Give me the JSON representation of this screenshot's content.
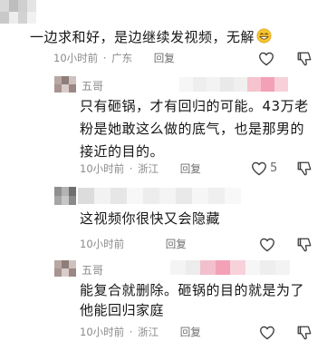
{
  "comments": [
    {
      "author": "",
      "text": "一边求和好，是边继续发视频，无解",
      "emoji": "grinning-face-emoji",
      "time": "10小时前",
      "location": "广东",
      "reply_label": "回复",
      "likes": ""
    },
    {
      "author": "五哥",
      "text": "只有砸锅，才有回归的可能。43万老粉是她敢这么做的底气，也是那男的接近的目的。",
      "time": "10小时前",
      "location": "浙江",
      "reply_label": "回复",
      "likes": "5"
    },
    {
      "author": "",
      "text": "这视频你很快又会隐藏",
      "time": "10小时前",
      "location": "",
      "reply_label": "回复",
      "likes": ""
    },
    {
      "author": "五哥",
      "text": "能复合就删除。砸锅的目的就是为了他能回归家庭",
      "time": "10小时前",
      "location": "浙江",
      "reply_label": "回复",
      "likes": ""
    }
  ],
  "separator": "·",
  "colors": {
    "text": "#161616",
    "meta": "#8a8a8a",
    "icon": "#3a3a3a",
    "pink_mosaic": "#f3a1b6"
  }
}
